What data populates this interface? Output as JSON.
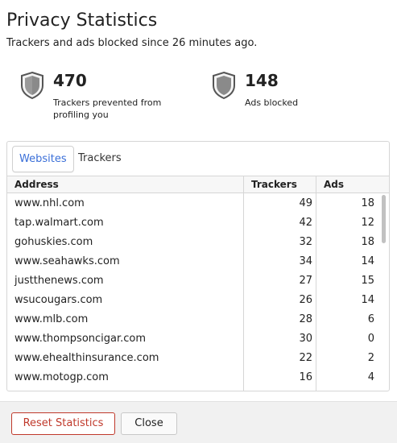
{
  "header": {
    "title": "Privacy Statistics",
    "subtitle": "Trackers and ads blocked since 26 minutes ago."
  },
  "stats": {
    "trackers": {
      "value": "470",
      "label": "Trackers prevented from profiling you",
      "icon": "shield-icon"
    },
    "ads": {
      "value": "148",
      "label": "Ads blocked",
      "icon": "shield-icon"
    }
  },
  "tabs": [
    {
      "label": "Websites",
      "active": true
    },
    {
      "label": "Trackers",
      "active": false
    }
  ],
  "table": {
    "columns": [
      "Address",
      "Trackers",
      "Ads"
    ],
    "rows": [
      [
        "www.nhl.com",
        "49",
        "18"
      ],
      [
        "tap.walmart.com",
        "42",
        "12"
      ],
      [
        "gohuskies.com",
        "32",
        "18"
      ],
      [
        "www.seahawks.com",
        "34",
        "14"
      ],
      [
        "justthenews.com",
        "27",
        "15"
      ],
      [
        "wsucougars.com",
        "26",
        "14"
      ],
      [
        "www.mlb.com",
        "28",
        "6"
      ],
      [
        "www.thompsoncigar.com",
        "30",
        "0"
      ],
      [
        "www.ehealthinsurance.com",
        "22",
        "2"
      ],
      [
        "www.motogp.com",
        "16",
        "4"
      ]
    ]
  },
  "footer": {
    "reset_label": "Reset Statistics",
    "close_label": "Close"
  },
  "colors": {
    "accent": "#3a6fd8",
    "danger": "#c0392b",
    "shield_fill": "#8a8a8a"
  }
}
